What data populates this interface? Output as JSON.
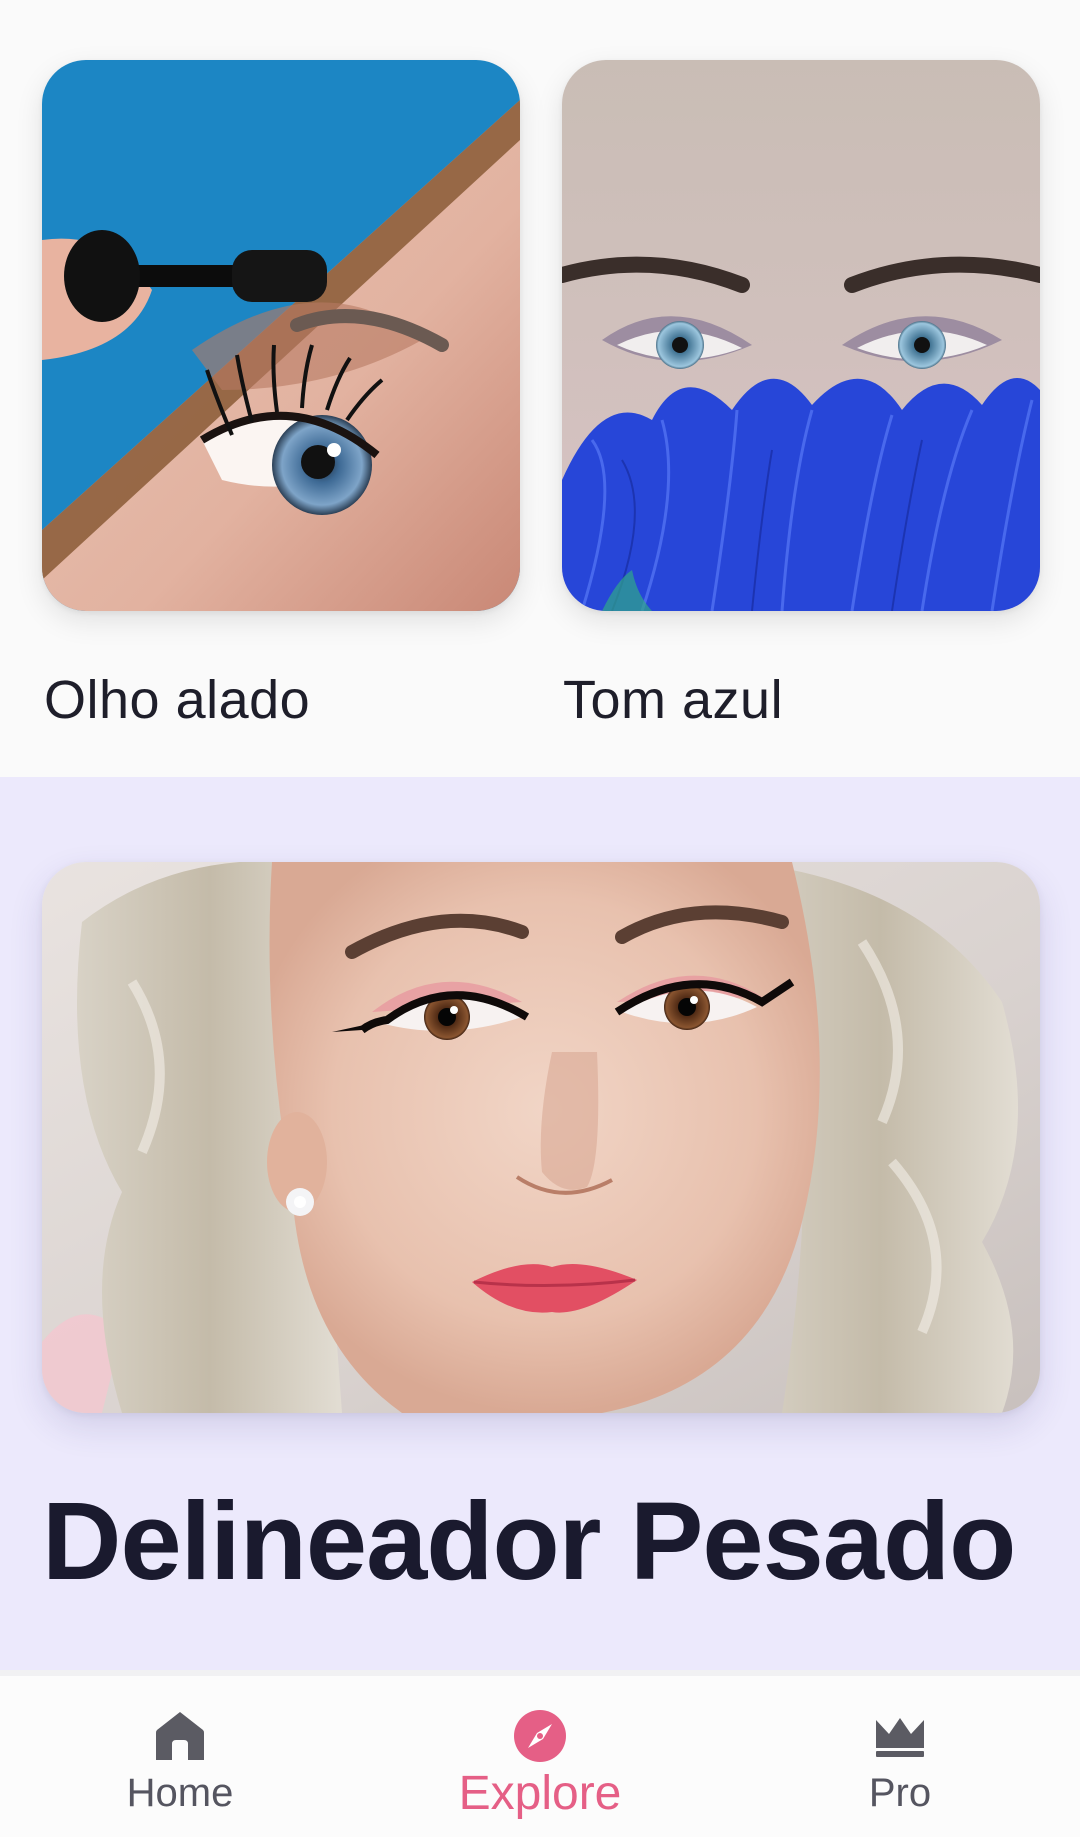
{
  "cards": [
    {
      "label": "Olho alado",
      "image": "eye-mascara-photo"
    },
    {
      "label": "Tom azul",
      "image": "blue-feather-eyes-photo"
    }
  ],
  "feature": {
    "title": "Delineador Pesado",
    "image": "heavy-eyeliner-portrait-photo"
  },
  "nav": {
    "items": [
      {
        "label": "Home",
        "icon": "home-icon",
        "active": false
      },
      {
        "label": "Explore",
        "icon": "compass-icon",
        "active": true
      },
      {
        "label": "Pro",
        "icon": "crown-icon",
        "active": false
      }
    ]
  },
  "colors": {
    "accent": "#e55f86",
    "feature_background": "#ece9fc",
    "title_text": "#1a1a2e",
    "inactive_nav": "#555560"
  }
}
